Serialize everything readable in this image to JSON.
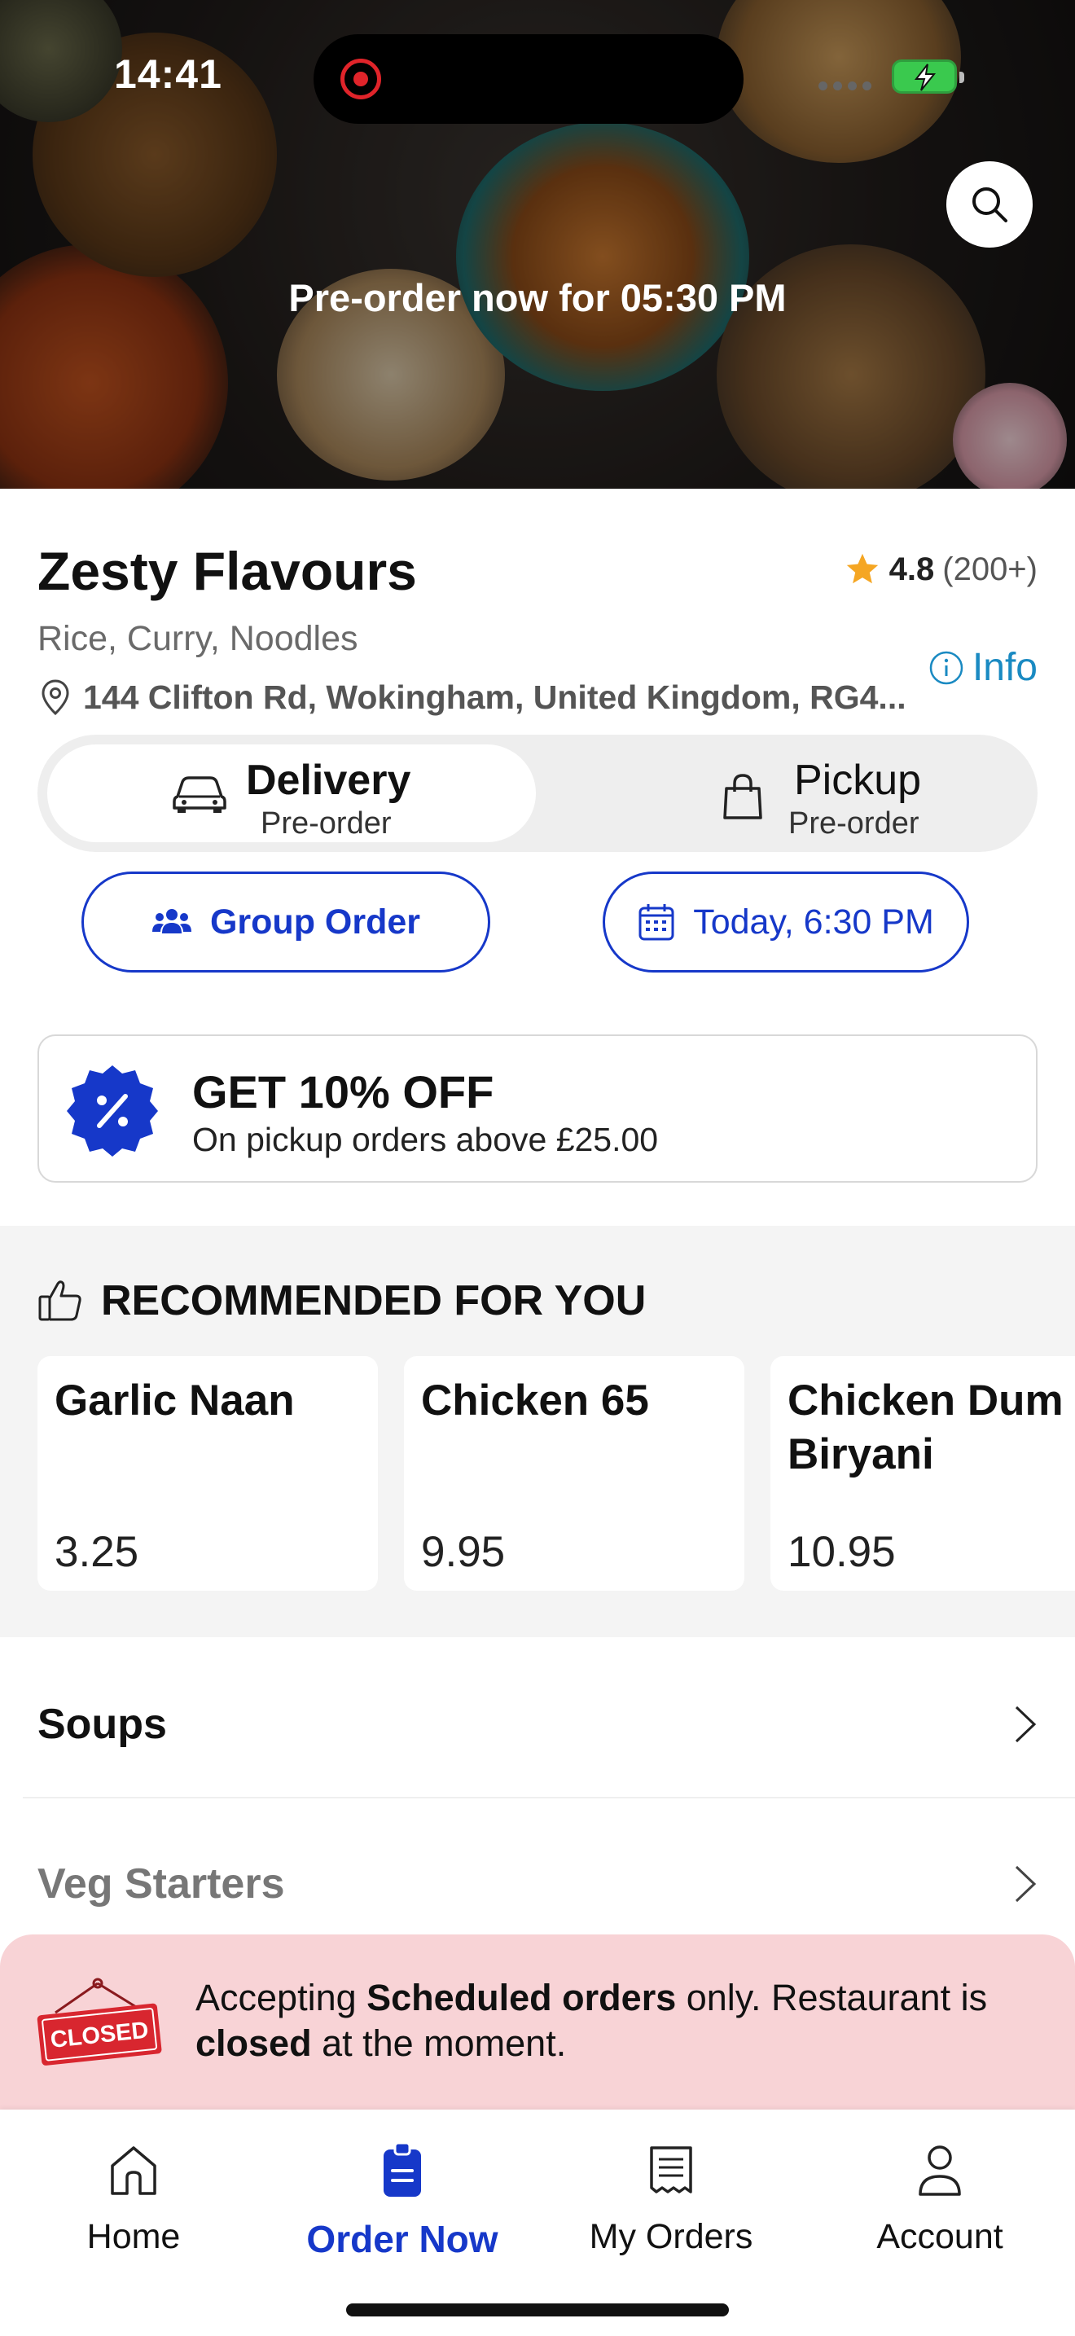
{
  "status_bar": {
    "time": "14:41"
  },
  "hero": {
    "preorder_text": "Pre-order now for 05:30 PM"
  },
  "restaurant": {
    "name": "Zesty Flavours",
    "rating": "4.8",
    "rating_count": "(200+)",
    "cuisines": "Rice, Curry, Noodles",
    "info_label": "Info",
    "address": "144 Clifton Rd, Wokingham, United Kingdom, RG4..."
  },
  "order_type": {
    "options": [
      {
        "label": "Delivery",
        "sub": "Pre-order",
        "selected": true
      },
      {
        "label": "Pickup",
        "sub": "Pre-order",
        "selected": false
      }
    ]
  },
  "actions": {
    "group_order_label": "Group Order",
    "schedule_label": "Today, 6:30 PM"
  },
  "promo": {
    "title": "GET 10% OFF",
    "subtitle": "On pickup orders above £25.00"
  },
  "recommended": {
    "heading": "RECOMMENDED FOR YOU",
    "items": [
      {
        "name": "Garlic Naan",
        "price": "3.25"
      },
      {
        "name": "Chicken 65",
        "price": "9.95"
      },
      {
        "name": "Chicken Dum Biryani",
        "price": "10.95"
      }
    ]
  },
  "categories": [
    {
      "name": "Soups"
    },
    {
      "name": "Veg Starters"
    }
  ],
  "closed_notice": {
    "sign_text": "CLOSED",
    "part1": "Accepting ",
    "bold1": "Scheduled orders",
    "part2": " only. Restaurant is ",
    "bold2": "closed",
    "part3": " at the moment."
  },
  "tab_bar": {
    "tabs": [
      {
        "label": "Home",
        "icon": "home-icon",
        "active": false
      },
      {
        "label": "Order Now",
        "icon": "order-now-icon",
        "active": true
      },
      {
        "label": "My Orders",
        "icon": "receipt-icon",
        "active": false
      },
      {
        "label": "Account",
        "icon": "user-icon",
        "active": false
      }
    ]
  },
  "colors": {
    "accent": "#1638c9",
    "info": "#1a8ac2",
    "star": "#f5a623",
    "closed_bg": "#f8d3d6",
    "closed_sign": "#d8262f"
  }
}
